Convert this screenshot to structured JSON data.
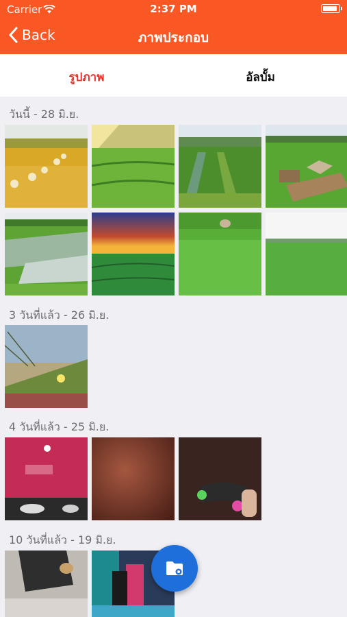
{
  "status_bar": {
    "carrier": "Carrier",
    "time": "2:37 PM"
  },
  "nav": {
    "back_label": "Back",
    "title": "ภาพประกอบ"
  },
  "tabs": [
    {
      "label": "รูปภาพ",
      "active": true
    },
    {
      "label": "อัลบั้ม",
      "active": false
    }
  ],
  "sections": [
    {
      "title": "วันนี้ - 28 มิ.ย.",
      "photo_count": 8
    },
    {
      "title": "3 วันที่แล้ว - 26 มิ.ย.",
      "photo_count": 1
    },
    {
      "title": "4 วันที่แล้ว - 25 มิ.ย.",
      "photo_count": 3
    },
    {
      "title": "10 วันที่แล้ว - 19 มิ.ย.",
      "photo_count": 2
    }
  ],
  "fab": {
    "icon": "folder-icon"
  },
  "colors": {
    "accent": "#f95724",
    "active_tab": "#e8332b",
    "fab": "#1e6fd9"
  }
}
